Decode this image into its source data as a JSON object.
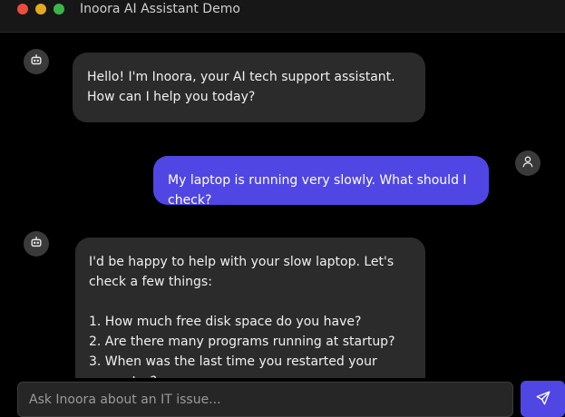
{
  "window": {
    "title": "Inoora AI Assistant Demo"
  },
  "messages": [
    {
      "role": "assistant",
      "avatar_icon": "bot-icon",
      "text": "Hello! I'm Inoora, your AI tech support assistant. How can I help you today?"
    },
    {
      "role": "user",
      "avatar_icon": "user-icon",
      "text": "My laptop is running very slowly. What should I check?"
    },
    {
      "role": "assistant",
      "avatar_icon": "bot-icon",
      "text": "I'd be happy to help with your slow laptop. Let's check a few things:\n\n1. How much free disk space do you have?\n2. Are there many programs running at startup?\n3. When was the last time you restarted your computer?"
    }
  ],
  "composer": {
    "placeholder": "Ask Inoora about an IT issue...",
    "value": "",
    "send_icon": "send-icon"
  },
  "colors": {
    "accent": "#5046e4",
    "bot_bubble": "#2b2b2b",
    "background": "#000000"
  }
}
